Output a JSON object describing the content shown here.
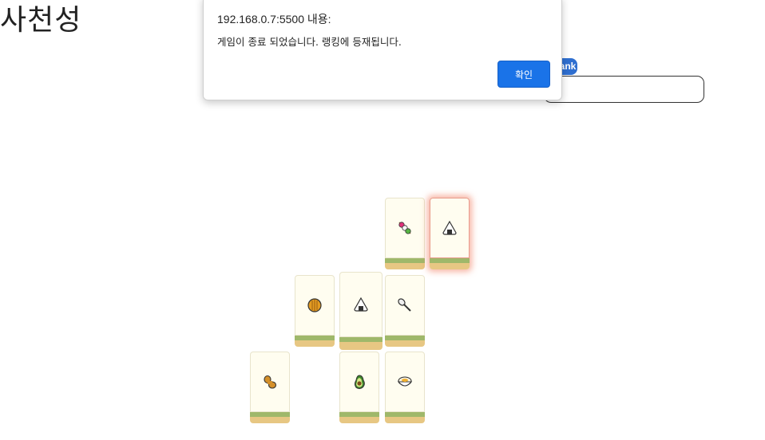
{
  "page": {
    "title": "사천성"
  },
  "ranking": {
    "button_label": "rank",
    "input_value": ""
  },
  "dialog": {
    "origin": "192.168.0.7:5500 내용:",
    "message": "게임이 종료 되었습니다. 랭킹에 등재됩니다.",
    "ok_label": "확인"
  },
  "board": {
    "tiles": [
      {
        "icon": "dango-icon",
        "selected": false
      },
      {
        "icon": "onigiri-icon",
        "selected": true
      },
      {
        "icon": "cookie-icon",
        "selected": false
      },
      {
        "icon": "onigiri-icon",
        "selected": false
      },
      {
        "icon": "spoon-icon",
        "selected": false
      },
      {
        "icon": "peanut-icon",
        "selected": false
      },
      {
        "icon": "avocado-icon",
        "selected": false
      },
      {
        "icon": "rice-bowl-icon",
        "selected": false
      }
    ]
  }
}
